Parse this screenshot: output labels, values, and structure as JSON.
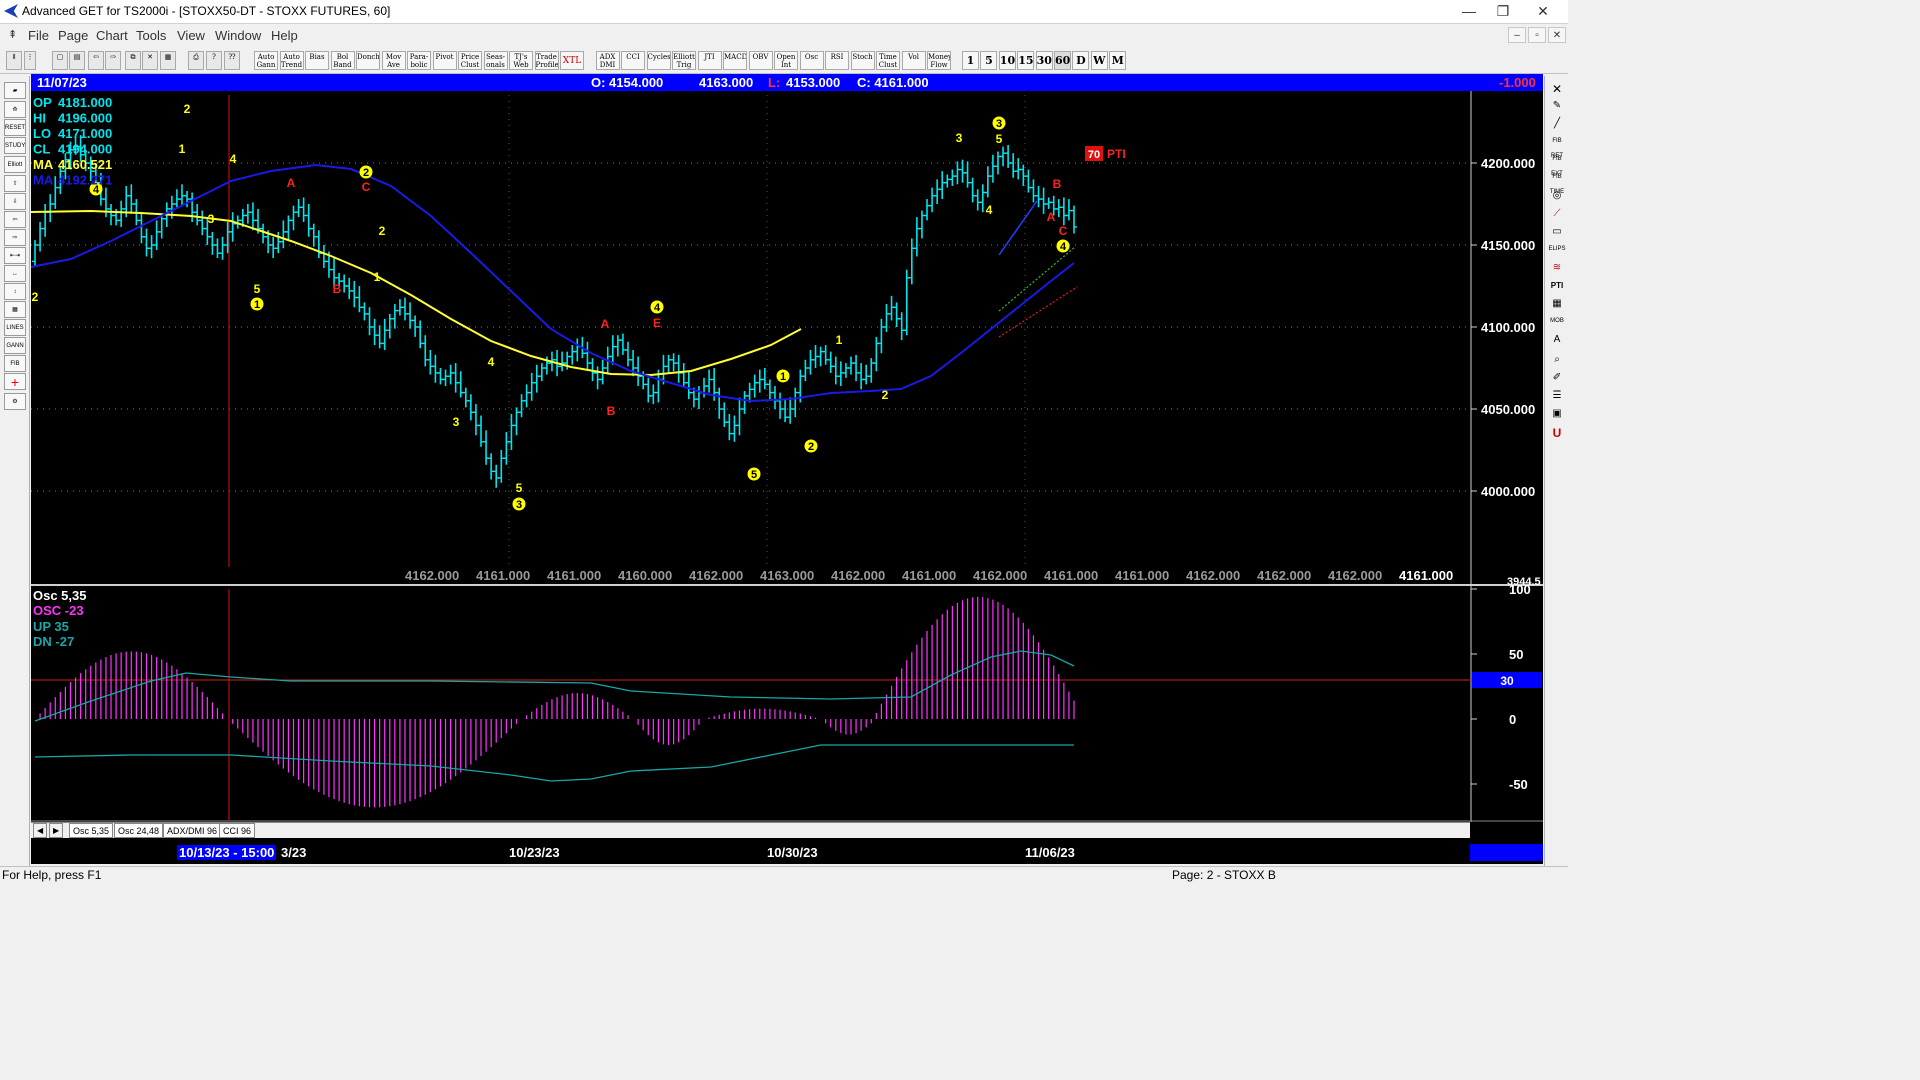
{
  "window": {
    "title": "Advanced GET for TS2000i - [STOXX50-DT - STOXX FUTURES, 60]",
    "controls": [
      "—",
      "❐",
      "✕"
    ]
  },
  "menu": [
    "File",
    "Page",
    "Chart",
    "Tools",
    "View",
    "Window",
    "Help"
  ],
  "mdi_controls": [
    "–",
    "▫",
    "✕"
  ],
  "toolbar": {
    "study_buttons": [
      "Auto Gann",
      "Auto Trend",
      "Bias",
      "Bol Band",
      "Donch",
      "Mov Ave",
      "Para-bolic",
      "Pivot",
      "Price Clust",
      "Seas-onals",
      "TJ's Web",
      "Trade Profile",
      "XTL",
      "ADX DMI",
      "CCI",
      "Cycles",
      "Elliott Trig",
      "JTI",
      "MACD",
      "OBV",
      "Open Int",
      "Osc",
      "RSI",
      "Stoch",
      "Time Clust",
      "Vol",
      "Money Flow"
    ],
    "timeframes": [
      "1",
      "5",
      "10",
      "15",
      "30",
      "60",
      "D",
      "W",
      "M"
    ]
  },
  "header_bar": {
    "date": "11/07/23",
    "open": "O: 4154.000",
    "high": "4163.000",
    "low_label": "L:",
    "low": "4153.000",
    "close": "C: 4161.000",
    "change": "-1.000"
  },
  "price_panel": {
    "info": [
      {
        "label": "OP",
        "value": "4181.000"
      },
      {
        "label": "HI",
        "value": "4196.000"
      },
      {
        "label": "LO",
        "value": "4171.000"
      },
      {
        "label": "CL",
        "value": "4194.000"
      },
      {
        "label": "MA",
        "value": "4160.521"
      },
      {
        "label": "MA",
        "value": "4192.271"
      }
    ],
    "y_ticks": [
      "4200.000",
      "4150.000",
      "4100.000",
      "4050.000",
      "4000.000"
    ],
    "y_cutoff": "3944.5",
    "pivot_row": [
      "4162.000",
      "4161.000",
      "4161.000",
      "4160.000",
      "4162.000",
      "4163.000",
      "4162.000",
      "4161.000",
      "4162.000",
      "4161.000",
      "4161.000",
      "4162.000",
      "4162.000",
      "4162.000"
    ],
    "pivot_last": "4161.000",
    "pti_value": "70",
    "pti_label": "PTI",
    "colors": {
      "ma_blue": "#1a1ae6",
      "ma_yellow": "#ffff33",
      "bars": "#00e5ee",
      "wave": "#ffff00",
      "abc": "#ff2020"
    }
  },
  "osc_panel": {
    "name": "Osc 5,35",
    "osc": "OSC -23",
    "up": "UP   35",
    "dn": "DN   -27",
    "y_ticks": [
      "100",
      "50",
      "0",
      "-50"
    ],
    "level_value": "30",
    "colors": {
      "osc": "#ff33ff",
      "band": "#1aa6a6",
      "level": "#ff0000"
    }
  },
  "tabs": [
    "Osc 5,35",
    "Osc 24,48",
    "ADX/DMI 96",
    "CCI 96"
  ],
  "date_axis": {
    "cursor_date": "10/13/23 - 15:00",
    "cursor_tail": "3/23",
    "labels": [
      "10/23/23",
      "10/30/23",
      "11/06/23"
    ]
  },
  "status": {
    "help": "For Help, press F1",
    "page": "Page: 2 - STOXX B"
  }
}
